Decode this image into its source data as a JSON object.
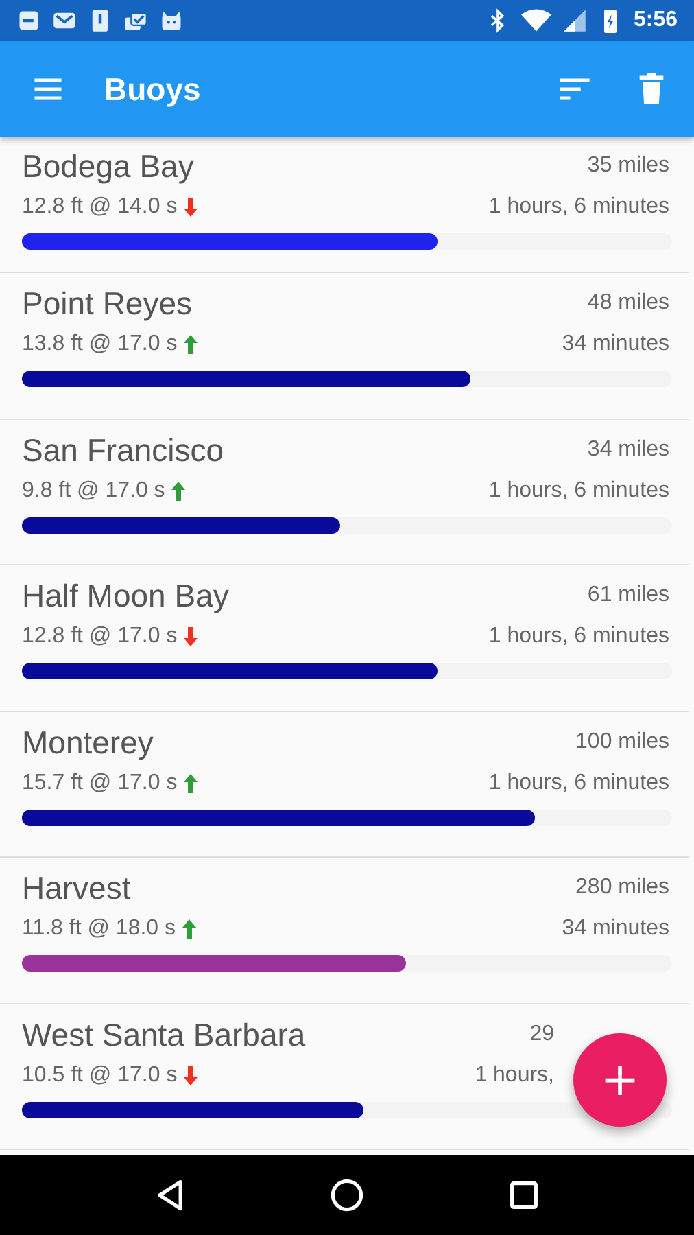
{
  "status_bar": {
    "time": "5:56"
  },
  "app_bar": {
    "title": "Buoys"
  },
  "buoys": [
    {
      "name": "Bodega Bay",
      "swell": "12.8 ft @ 14.0 s",
      "rising": false,
      "distance": "35 miles",
      "eta": "1 hours, 6 minutes",
      "level": 0.64,
      "color": "#2222ee"
    },
    {
      "name": "Point Reyes",
      "swell": "13.8 ft @ 17.0 s",
      "rising": true,
      "distance": "48 miles",
      "eta": "34 minutes",
      "level": 0.69,
      "color": "#0a0a9a"
    },
    {
      "name": "San Francisco",
      "swell": "9.8 ft @ 17.0 s",
      "rising": true,
      "distance": "34 miles",
      "eta": "1 hours, 6 minutes",
      "level": 0.49,
      "color": "#0a0a9a"
    },
    {
      "name": "Half Moon Bay",
      "swell": "12.8 ft @ 17.0 s",
      "rising": false,
      "distance": "61 miles",
      "eta": "1 hours, 6 minutes",
      "level": 0.64,
      "color": "#0a0a9a"
    },
    {
      "name": "Monterey",
      "swell": "15.7 ft @ 17.0 s",
      "rising": true,
      "distance": "100 miles",
      "eta": "1 hours, 6 minutes",
      "level": 0.79,
      "color": "#0a0a9a"
    },
    {
      "name": "Harvest",
      "swell": "11.8 ft @ 18.0 s",
      "rising": true,
      "distance": "280 miles",
      "eta": "34 minutes",
      "level": 0.59,
      "color": "#993399"
    },
    {
      "name": "West Santa Barbara",
      "swell": "10.5 ft @ 17.0 s",
      "rising": false,
      "distance": "29",
      "eta": "1 hours,",
      "level": 0.525,
      "color": "#0a0a9a"
    }
  ],
  "fab": {
    "label": "+"
  }
}
